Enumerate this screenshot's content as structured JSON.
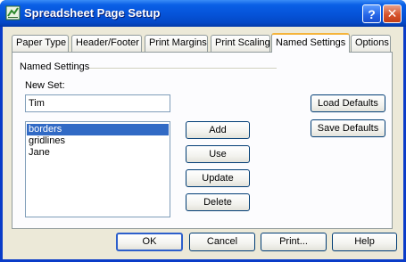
{
  "window": {
    "title": "Spreadsheet Page Setup",
    "help_button": "?",
    "close_button": "✕"
  },
  "tabs": [
    {
      "label": "Paper Type"
    },
    {
      "label": "Header/Footer"
    },
    {
      "label": "Print Margins"
    },
    {
      "label": "Print Scaling"
    },
    {
      "label": "Named Settings",
      "active": true
    },
    {
      "label": "Options"
    }
  ],
  "named_settings": {
    "group_label": "Named Settings",
    "new_set_label": "New Set:",
    "new_set_value": "Tim",
    "list_items": [
      {
        "label": "borders",
        "selected": true
      },
      {
        "label": "gridlines"
      },
      {
        "label": "Jane"
      }
    ],
    "buttons": {
      "add": "Add",
      "use": "Use",
      "update": "Update",
      "delete": "Delete",
      "load_defaults": "Load Defaults",
      "save_defaults": "Save Defaults"
    }
  },
  "footer": {
    "ok": "OK",
    "cancel": "Cancel",
    "print": "Print...",
    "help": "Help"
  },
  "colors": {
    "titlebar": "#0553d8",
    "dialog_bg": "#ece9d8",
    "selection": "#316ac5",
    "active_tab_accent": "#f5b43b"
  }
}
